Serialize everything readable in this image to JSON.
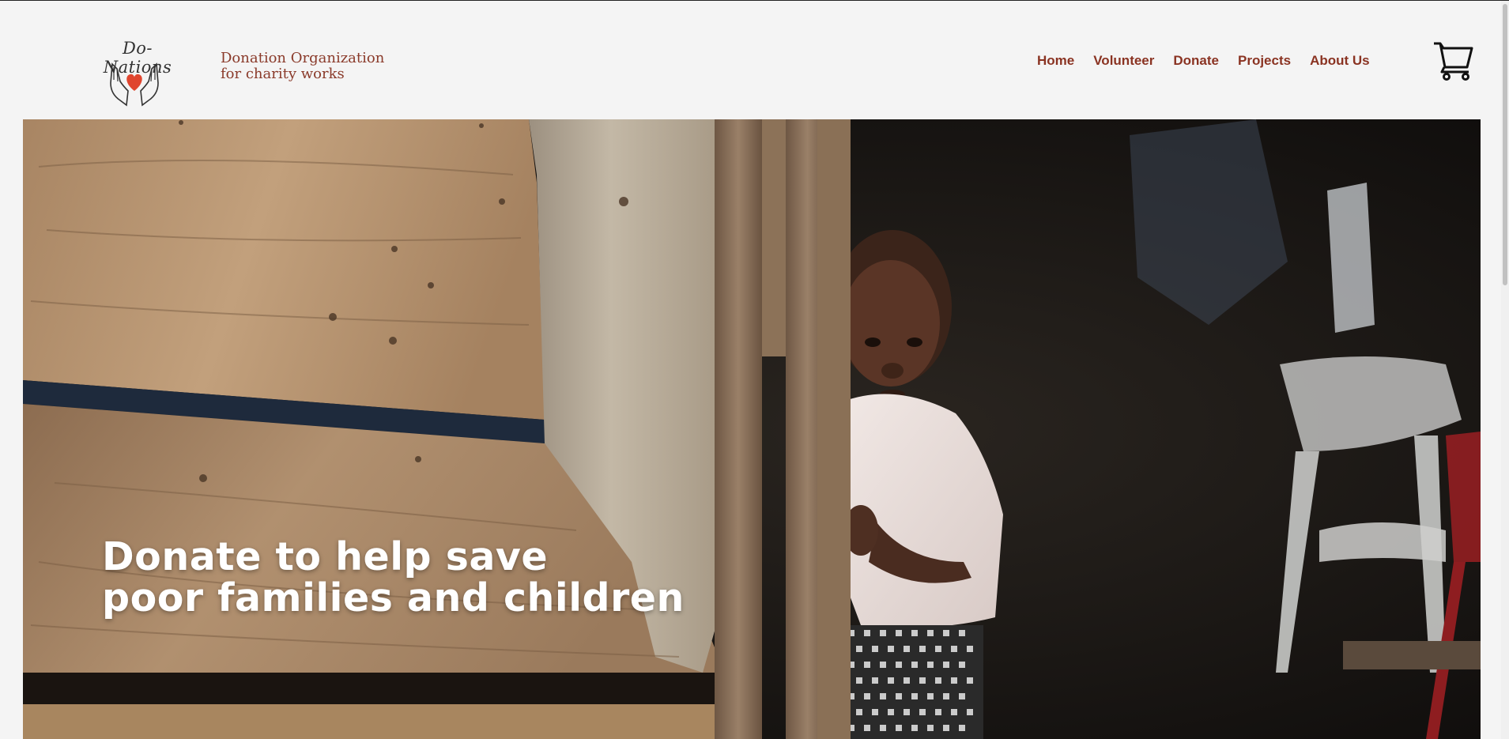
{
  "brand": {
    "name": "Do-Nations",
    "tagline_line1": "Donation Organization",
    "tagline_line2": "for charity works",
    "accent_color": "#8a3322",
    "heart_color": "#e0452e"
  },
  "nav": {
    "items": [
      {
        "label": "Home"
      },
      {
        "label": "Volunteer"
      },
      {
        "label": "Donate"
      },
      {
        "label": "Projects"
      },
      {
        "label": "About Us"
      }
    ],
    "cart_icon": "cart-icon"
  },
  "hero": {
    "title_line1": "Donate to help save",
    "title_line2": "poor families and children"
  }
}
